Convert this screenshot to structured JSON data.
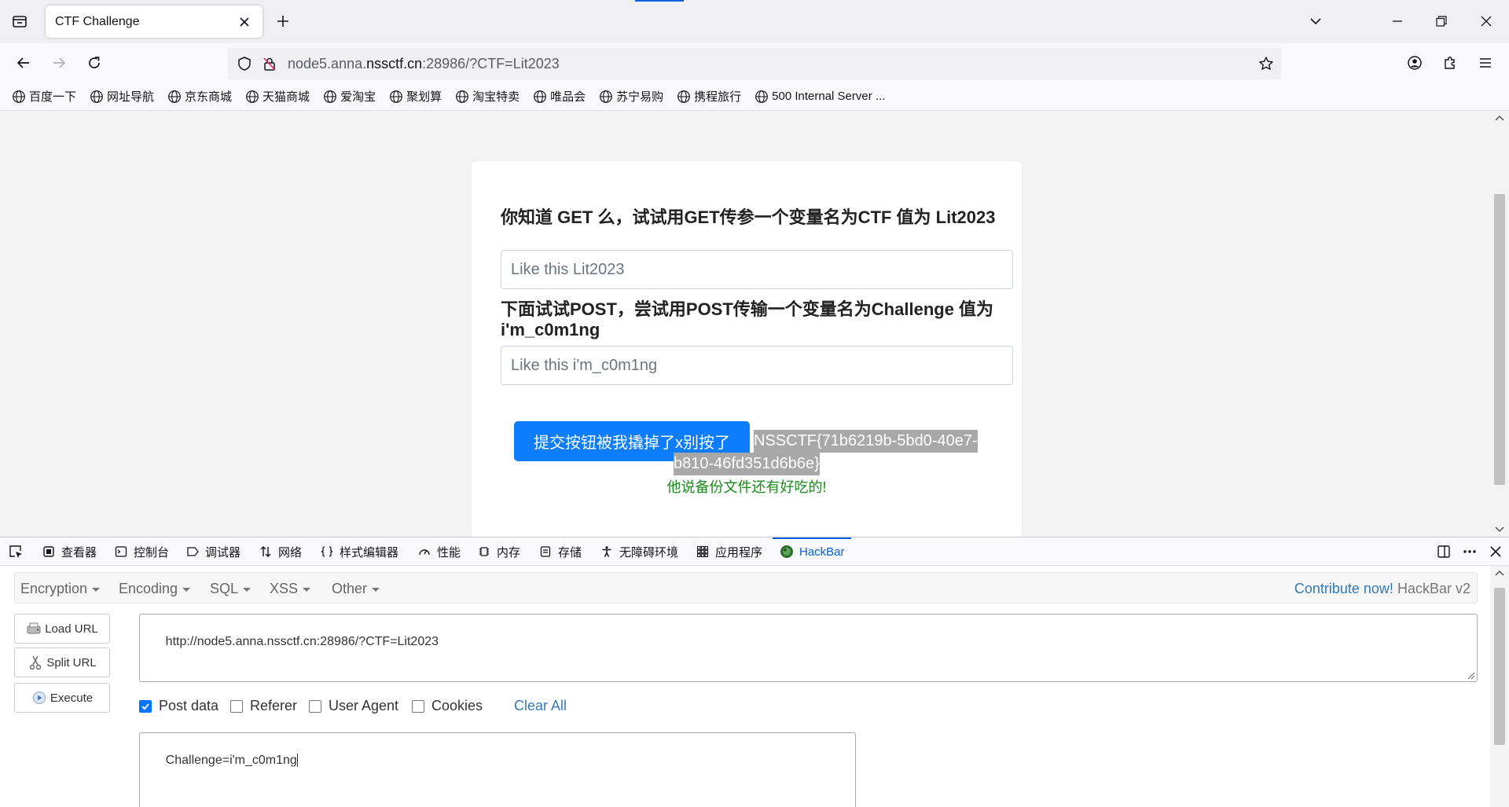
{
  "browser": {
    "tab": {
      "title": "CTF Challenge"
    },
    "url": {
      "prefix": "node5.anna.",
      "domain": "nssctf.cn",
      "suffix": ":28986/?CTF=Lit2023"
    },
    "bookmarks": [
      "百度一下",
      "网址导航",
      "京东商城",
      "天猫商城",
      "爱淘宝",
      "聚划算",
      "淘宝特卖",
      "唯品会",
      "苏宁易购",
      "携程旅行",
      "500 Internal Server ..."
    ]
  },
  "page": {
    "get_question": "你知道 GET 么，试试用GET传参一个变量名为CTF 值为 Lit2023",
    "get_placeholder": "Like this Lit2023",
    "post_question": "下面试试POST，尝试用POST传输一个变量名为Challenge 值为 i'm_c0m1ng",
    "post_placeholder": "Like this i'm_c0m1ng",
    "submit_label": "提交按钮被我撬掉了x别按了",
    "flag_line1": "NSSCTF{71b6219b-5bd0-40e7-",
    "flag_line2": "b810-46fd351d6b6e}",
    "hint": "他说备份文件还有好吃的!"
  },
  "devtools": {
    "tabs": [
      {
        "label": "查看器",
        "icon": "inspector-icon"
      },
      {
        "label": "控制台",
        "icon": "console-icon"
      },
      {
        "label": "调试器",
        "icon": "debugger-icon"
      },
      {
        "label": "网络",
        "icon": "network-icon"
      },
      {
        "label": "样式编辑器",
        "icon": "style-editor-icon"
      },
      {
        "label": "性能",
        "icon": "performance-icon"
      },
      {
        "label": "内存",
        "icon": "memory-icon"
      },
      {
        "label": "存储",
        "icon": "storage-icon"
      },
      {
        "label": "无障碍环境",
        "icon": "accessibility-icon"
      },
      {
        "label": "应用程序",
        "icon": "application-icon"
      },
      {
        "label": "HackBar",
        "icon": "hackbar-icon",
        "active": true
      }
    ]
  },
  "hackbar": {
    "menu": [
      "Encryption",
      "Encoding",
      "SQL",
      "XSS",
      "Other"
    ],
    "contribute_link": "Contribute now!",
    "version": "HackBar v2",
    "buttons": {
      "load": "Load URL",
      "split": "Split URL",
      "execute": "Execute"
    },
    "url_value": "http://node5.anna.nssctf.cn:28986/?CTF=Lit2023",
    "options": [
      {
        "label": "Post data",
        "checked": true
      },
      {
        "label": "Referer",
        "checked": false
      },
      {
        "label": "User Agent",
        "checked": false
      },
      {
        "label": "Cookies",
        "checked": false
      }
    ],
    "clear_all": "Clear All",
    "post_value": "Challenge=i'm_c0m1ng"
  },
  "colors": {
    "accent": "#0061e0",
    "submit_button": "#0d7dfd",
    "hint_text": "#1a8a1a",
    "link": "#337ab7"
  }
}
